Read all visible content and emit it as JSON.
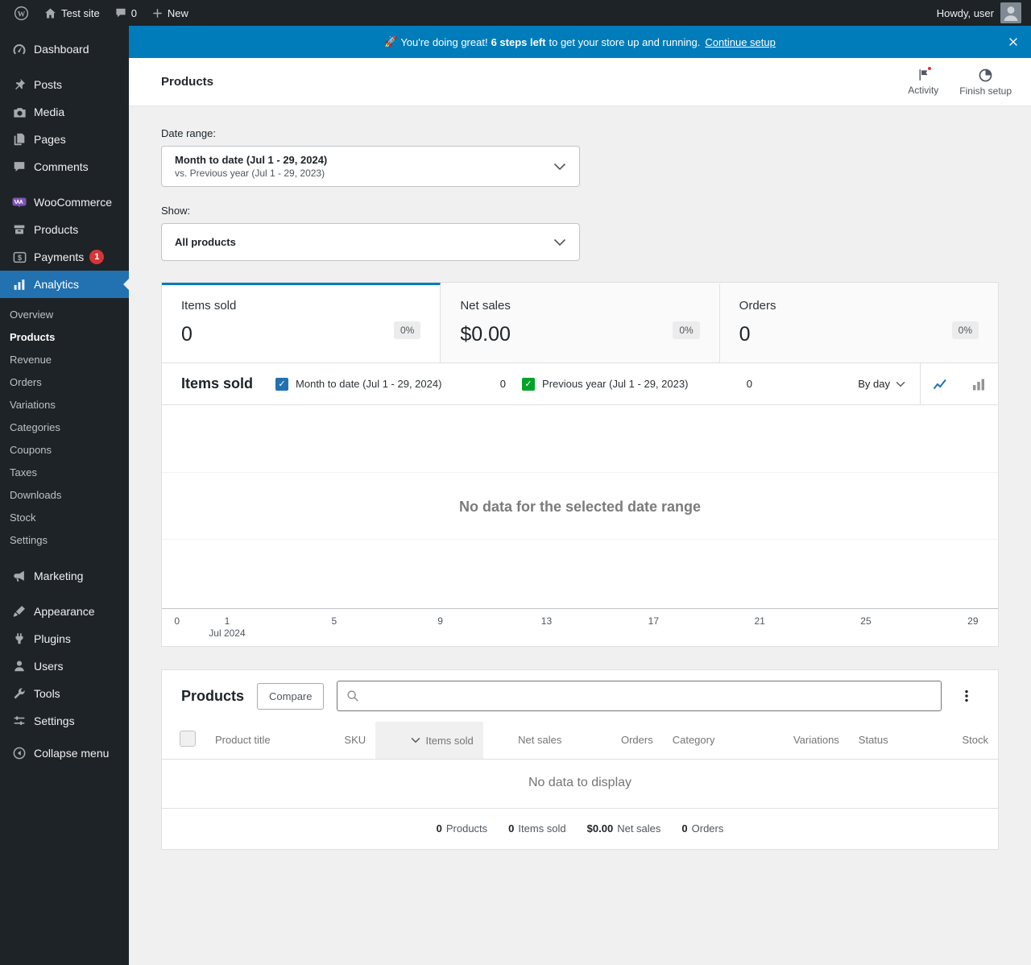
{
  "admin_bar": {
    "site_name": "Test site",
    "comment_count": "0",
    "new_label": "New",
    "howdy": "Howdy, user"
  },
  "banner": {
    "emoji": "🚀",
    "message": "You're doing great!",
    "bold": "6 steps left",
    "suffix": "to get your store up and running.",
    "link_label": "Continue setup"
  },
  "page_header": {
    "title": "Products",
    "activity_label": "Activity",
    "finish_setup_label": "Finish setup"
  },
  "sidebar": {
    "items": [
      {
        "label": "Dashboard"
      },
      {
        "label": "Posts"
      },
      {
        "label": "Media"
      },
      {
        "label": "Pages"
      },
      {
        "label": "Comments"
      },
      {
        "label": "WooCommerce"
      },
      {
        "label": "Products"
      },
      {
        "label": "Payments",
        "badge": "1"
      },
      {
        "label": "Analytics"
      },
      {
        "label": "Marketing"
      },
      {
        "label": "Appearance"
      },
      {
        "label": "Plugins"
      },
      {
        "label": "Users"
      },
      {
        "label": "Tools"
      },
      {
        "label": "Settings"
      },
      {
        "label": "Collapse menu"
      }
    ],
    "analytics_submenu": [
      "Overview",
      "Products",
      "Revenue",
      "Orders",
      "Variations",
      "Categories",
      "Coupons",
      "Taxes",
      "Downloads",
      "Stock",
      "Settings"
    ]
  },
  "filters": {
    "date_range_label": "Date range:",
    "date_range_value": "Month to date (Jul 1 - 29, 2024)",
    "date_range_compare": "vs. Previous year (Jul 1 - 29, 2023)",
    "show_label": "Show:",
    "show_value": "All products"
  },
  "stats": [
    {
      "label": "Items sold",
      "value": "0",
      "delta": "0%"
    },
    {
      "label": "Net sales",
      "value": "$0.00",
      "delta": "0%"
    },
    {
      "label": "Orders",
      "value": "0",
      "delta": "0%"
    }
  ],
  "chart": {
    "title": "Items sold",
    "legend": [
      {
        "label": "Month to date (Jul 1 - 29, 2024)",
        "value": "0"
      },
      {
        "label": "Previous year (Jul 1 - 29, 2023)",
        "value": "0"
      }
    ],
    "interval": "By day",
    "empty_message": "No data for the selected date range",
    "x_ticks": [
      "0",
      "1",
      "5",
      "9",
      "13",
      "17",
      "21",
      "25",
      "29"
    ],
    "x_month": "Jul 2024"
  },
  "table": {
    "title": "Products",
    "compare_label": "Compare",
    "search_value": "",
    "columns": [
      "Product title",
      "SKU",
      "Items sold",
      "Net sales",
      "Orders",
      "Category",
      "Variations",
      "Status",
      "Stock"
    ],
    "empty_message": "No data to display",
    "summary": [
      {
        "value": "0",
        "label": "Products"
      },
      {
        "value": "0",
        "label": "Items sold"
      },
      {
        "value": "$0.00",
        "label": "Net sales"
      },
      {
        "value": "0",
        "label": "Orders"
      }
    ]
  },
  "colors": {
    "accent_blue": "#2271b1",
    "banner_blue": "#007cba",
    "series_current": "#2271b1",
    "series_previous": "#00a32a",
    "notice_red": "#d63638",
    "sidebar_bg": "#1d2327"
  }
}
